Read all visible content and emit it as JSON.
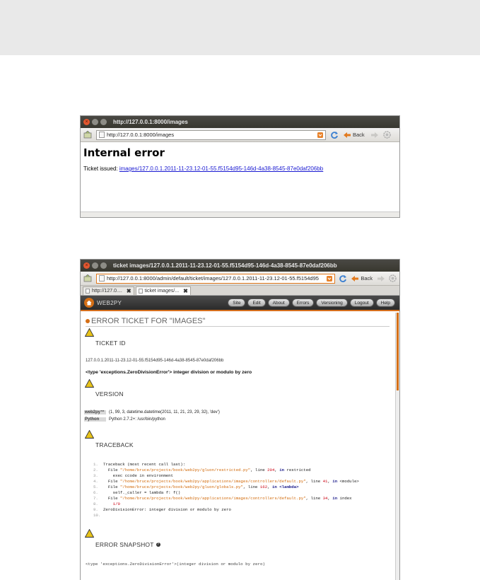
{
  "window1": {
    "title": "http://127.0.0.1:8000/images",
    "url": "http://127.0.0.1:8000/images",
    "back_label": "Back",
    "heading": "Internal error",
    "ticket_prefix": "Ticket issued:",
    "ticket_link": "images/127.0.0.1.2011-11-23.12-01-55.f5154d95-146d-4a38-8545-87e0daf206bb"
  },
  "window2": {
    "title": "ticket images/127.0.0.1.2011-11-23.12-01-55.f5154d95-146d-4a38-8545-87e0daf206bb",
    "url": "http://127.0.0.1:8000/admin/default/ticket/images/127.0.0.1.2011-11-23.12-01-55.f5154d95",
    "back_label": "Back",
    "tabs": [
      {
        "label": "http://127.0...."
      },
      {
        "label": "ticket images/..."
      }
    ],
    "brand": "WEB2PY",
    "menu": [
      "Site",
      "Edit",
      "About",
      "Errors",
      "Versioning",
      "Logout",
      "Help"
    ],
    "page_title": "ERROR TICKET FOR \"IMAGES\"",
    "ticket_id_heading": "TICKET ID",
    "ticket_id": "127.0.0.1.2011-11-23.12-01-55.f5154d95-146d-4a38-8545-87e0daf206bb",
    "exception": "<type 'exceptions.ZeroDivisionError'> integer division or modulo by zero",
    "version_heading": "VERSION",
    "versions": [
      {
        "name": "web2py™",
        "value": "(1, 99, 3, datetime.datetime(2011, 11, 21, 23, 29, 32), 'dev')"
      },
      {
        "name": "Python",
        "value": "Python 2.7.2+: /usr/bin/python"
      }
    ],
    "traceback_heading": "TRACEBACK",
    "traceback": {
      "l1": "Traceback (most recent call last):",
      "l2_path": "\"/home/bruce/projects/book/web2py/gluon/restricted.py\"",
      "l2_line": "204",
      "l2_func": "restricted",
      "l3": "exec ccode in environment",
      "l4_path": "\"/home/bruce/projects/book/web2py/applications/images/controllers/default.py\"",
      "l4_line": "41",
      "l4_func": "<module>",
      "l5_path": "\"/home/bruce/projects/book/web2py/gluon/globals.py\"",
      "l5_line": "162",
      "l5_func": "<lambda>",
      "l6": "self._caller = lambda f: f()",
      "l7_path": "\"/home/bruce/projects/book/web2py/applications/images/controllers/default.py\"",
      "l7_line": "34",
      "l7_func": "index",
      "l8": "1/0",
      "l9": "ZeroDivisionError: integer division or modulo by zero",
      "kw_file": "File",
      "kw_line": "line",
      "kw_in": "in"
    },
    "snapshot_heading": "ERROR SNAPSHOT",
    "snapshot_text": "<type 'exceptions.ZeroDivisionError'>(integer division or modulo by zero)"
  }
}
